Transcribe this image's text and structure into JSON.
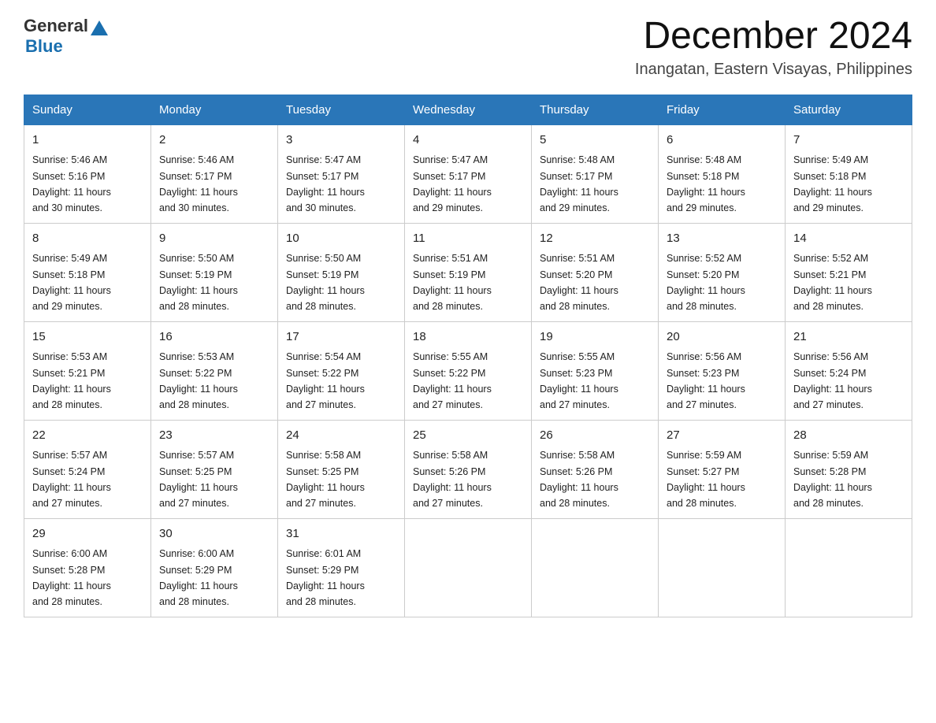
{
  "header": {
    "logo": {
      "general": "General",
      "blue": "Blue"
    },
    "title": "December 2024",
    "location": "Inangatan, Eastern Visayas, Philippines"
  },
  "days_of_week": [
    "Sunday",
    "Monday",
    "Tuesday",
    "Wednesday",
    "Thursday",
    "Friday",
    "Saturday"
  ],
  "weeks": [
    [
      {
        "day": "1",
        "sunrise": "5:46 AM",
        "sunset": "5:16 PM",
        "daylight": "11 hours and 30 minutes."
      },
      {
        "day": "2",
        "sunrise": "5:46 AM",
        "sunset": "5:17 PM",
        "daylight": "11 hours and 30 minutes."
      },
      {
        "day": "3",
        "sunrise": "5:47 AM",
        "sunset": "5:17 PM",
        "daylight": "11 hours and 30 minutes."
      },
      {
        "day": "4",
        "sunrise": "5:47 AM",
        "sunset": "5:17 PM",
        "daylight": "11 hours and 29 minutes."
      },
      {
        "day": "5",
        "sunrise": "5:48 AM",
        "sunset": "5:17 PM",
        "daylight": "11 hours and 29 minutes."
      },
      {
        "day": "6",
        "sunrise": "5:48 AM",
        "sunset": "5:18 PM",
        "daylight": "11 hours and 29 minutes."
      },
      {
        "day": "7",
        "sunrise": "5:49 AM",
        "sunset": "5:18 PM",
        "daylight": "11 hours and 29 minutes."
      }
    ],
    [
      {
        "day": "8",
        "sunrise": "5:49 AM",
        "sunset": "5:18 PM",
        "daylight": "11 hours and 29 minutes."
      },
      {
        "day": "9",
        "sunrise": "5:50 AM",
        "sunset": "5:19 PM",
        "daylight": "11 hours and 28 minutes."
      },
      {
        "day": "10",
        "sunrise": "5:50 AM",
        "sunset": "5:19 PM",
        "daylight": "11 hours and 28 minutes."
      },
      {
        "day": "11",
        "sunrise": "5:51 AM",
        "sunset": "5:19 PM",
        "daylight": "11 hours and 28 minutes."
      },
      {
        "day": "12",
        "sunrise": "5:51 AM",
        "sunset": "5:20 PM",
        "daylight": "11 hours and 28 minutes."
      },
      {
        "day": "13",
        "sunrise": "5:52 AM",
        "sunset": "5:20 PM",
        "daylight": "11 hours and 28 minutes."
      },
      {
        "day": "14",
        "sunrise": "5:52 AM",
        "sunset": "5:21 PM",
        "daylight": "11 hours and 28 minutes."
      }
    ],
    [
      {
        "day": "15",
        "sunrise": "5:53 AM",
        "sunset": "5:21 PM",
        "daylight": "11 hours and 28 minutes."
      },
      {
        "day": "16",
        "sunrise": "5:53 AM",
        "sunset": "5:22 PM",
        "daylight": "11 hours and 28 minutes."
      },
      {
        "day": "17",
        "sunrise": "5:54 AM",
        "sunset": "5:22 PM",
        "daylight": "11 hours and 27 minutes."
      },
      {
        "day": "18",
        "sunrise": "5:55 AM",
        "sunset": "5:22 PM",
        "daylight": "11 hours and 27 minutes."
      },
      {
        "day": "19",
        "sunrise": "5:55 AM",
        "sunset": "5:23 PM",
        "daylight": "11 hours and 27 minutes."
      },
      {
        "day": "20",
        "sunrise": "5:56 AM",
        "sunset": "5:23 PM",
        "daylight": "11 hours and 27 minutes."
      },
      {
        "day": "21",
        "sunrise": "5:56 AM",
        "sunset": "5:24 PM",
        "daylight": "11 hours and 27 minutes."
      }
    ],
    [
      {
        "day": "22",
        "sunrise": "5:57 AM",
        "sunset": "5:24 PM",
        "daylight": "11 hours and 27 minutes."
      },
      {
        "day": "23",
        "sunrise": "5:57 AM",
        "sunset": "5:25 PM",
        "daylight": "11 hours and 27 minutes."
      },
      {
        "day": "24",
        "sunrise": "5:58 AM",
        "sunset": "5:25 PM",
        "daylight": "11 hours and 27 minutes."
      },
      {
        "day": "25",
        "sunrise": "5:58 AM",
        "sunset": "5:26 PM",
        "daylight": "11 hours and 27 minutes."
      },
      {
        "day": "26",
        "sunrise": "5:58 AM",
        "sunset": "5:26 PM",
        "daylight": "11 hours and 28 minutes."
      },
      {
        "day": "27",
        "sunrise": "5:59 AM",
        "sunset": "5:27 PM",
        "daylight": "11 hours and 28 minutes."
      },
      {
        "day": "28",
        "sunrise": "5:59 AM",
        "sunset": "5:28 PM",
        "daylight": "11 hours and 28 minutes."
      }
    ],
    [
      {
        "day": "29",
        "sunrise": "6:00 AM",
        "sunset": "5:28 PM",
        "daylight": "11 hours and 28 minutes."
      },
      {
        "day": "30",
        "sunrise": "6:00 AM",
        "sunset": "5:29 PM",
        "daylight": "11 hours and 28 minutes."
      },
      {
        "day": "31",
        "sunrise": "6:01 AM",
        "sunset": "5:29 PM",
        "daylight": "11 hours and 28 minutes."
      },
      null,
      null,
      null,
      null
    ]
  ],
  "labels": {
    "sunrise": "Sunrise:",
    "sunset": "Sunset:",
    "daylight": "Daylight:"
  }
}
